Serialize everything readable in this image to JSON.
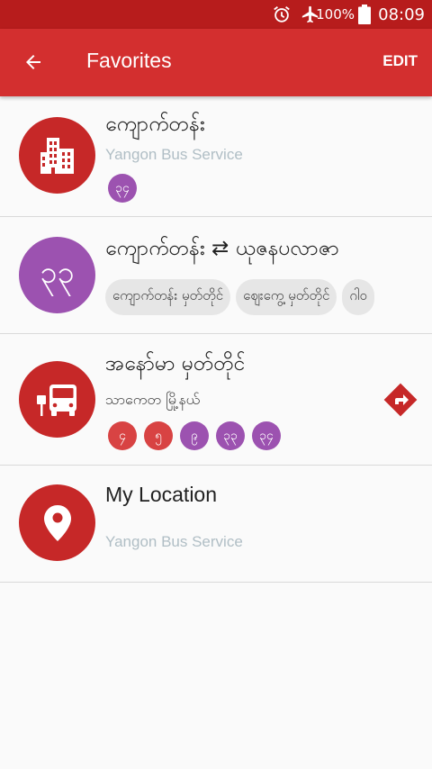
{
  "status_bar": {
    "battery_percent": "100%",
    "time": "08:09",
    "icons": [
      "alarm-icon",
      "airplane-icon",
      "battery-icon"
    ]
  },
  "app_bar": {
    "title": "Favorites",
    "edit_label": "EDIT",
    "back_icon": "arrow-left-icon"
  },
  "colors": {
    "primary": "#d32f2f",
    "status_bar": "#b71c1c",
    "purple": "#9c52b0",
    "subtitle_gray": "#b0bec5"
  },
  "favorites": [
    {
      "type": "stop",
      "icon": "building-icon",
      "title": "ကျောက်တန်း",
      "subtitle": "Yangon Bus Service",
      "routes": [
        "၃၄"
      ]
    },
    {
      "type": "route",
      "icon_text": "၃၃",
      "title": "ကျောက်တန်း ⇄ ယုဇနပလာဇာ",
      "stops": [
        "ကျောက်တန်း မှတ်တိုင်",
        "ဈေးကွေ့ မှတ်တိုင်",
        "ဂါဝ"
      ]
    },
    {
      "type": "bus_stop",
      "icon": "bus-stop-icon",
      "title": "အနော်မာ မှတ်တိုင်",
      "subtitle": "သာကေတ မြို့နယ်",
      "routes": [
        "၄",
        "၅",
        "၉",
        "၃၃",
        "၃၄"
      ],
      "action_icon": "directions-icon"
    },
    {
      "type": "location",
      "icon": "location-pin-icon",
      "title": "My Location",
      "subtitle": "Yangon Bus Service"
    }
  ]
}
